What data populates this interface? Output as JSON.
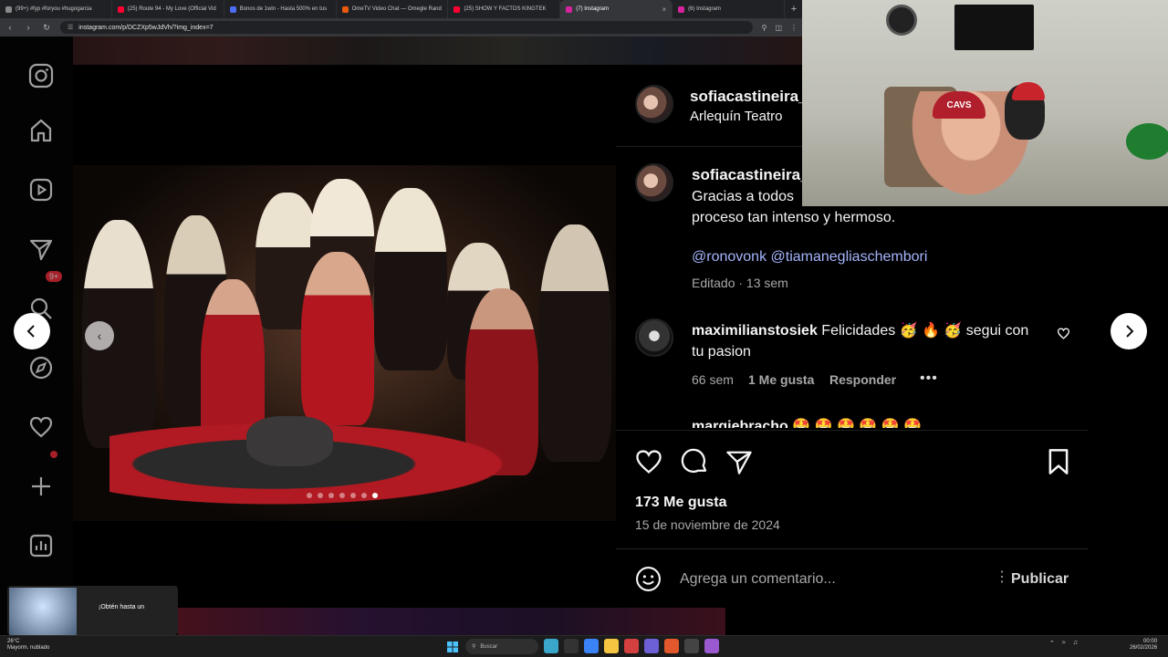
{
  "browser": {
    "tabs": [
      {
        "title": "(99+) #fyp #foryou #hugogarcia",
        "color": "#8a8a8a",
        "active": false
      },
      {
        "title": "(25) Route 94 - My Love (Official Vid",
        "color": "#ff0033",
        "active": false
      },
      {
        "title": "Bonos de 1win - Hasta 500% en tus",
        "color": "#4c6ef5",
        "active": false
      },
      {
        "title": "OmeTV Video Chat — Omegle Rand",
        "color": "#e8590c",
        "active": false
      },
      {
        "title": "(25) SHOW Y FACTOS KINGTEK",
        "color": "#ff0033",
        "active": false
      },
      {
        "title": "(7) Instagram",
        "color": "#d6249f",
        "active": true
      },
      {
        "title": "(6) Instagram",
        "color": "#d6249f",
        "active": false
      }
    ],
    "url": "instagram.com/p/DCZXp5wJdVh/?img_index=7"
  },
  "rail": {
    "badge": "9+",
    "items": [
      {
        "name": "instagram-logo-icon",
        "glyph": "logo"
      },
      {
        "name": "home-icon",
        "glyph": "home"
      },
      {
        "name": "reels-icon",
        "glyph": "reels"
      },
      {
        "name": "messages-icon",
        "glyph": "messages"
      },
      {
        "name": "search-icon",
        "glyph": "search"
      },
      {
        "name": "explore-icon",
        "glyph": "explore"
      },
      {
        "name": "notifications-icon",
        "glyph": "heart"
      },
      {
        "name": "create-icon",
        "glyph": "plus"
      },
      {
        "name": "dashboard-icon",
        "glyph": "dashboard"
      }
    ]
  },
  "post": {
    "carousel": {
      "total": 7,
      "current": 7
    },
    "author": "sofiacastineira_",
    "location": "Arlequín Teatro",
    "caption": {
      "username": "sofiacastineira_",
      "line1": "Gracias a todos",
      "line2": "proceso tan intenso y hermoso.",
      "mentions": "@ronovonk @tiamanegliaschembori",
      "meta": "Edited · 13 sem",
      "meta_display": "Editado · 13 sem"
    },
    "comments": [
      {
        "username": "maximilianstosiek",
        "text": "Felicidades 🥳 🔥 🥳 segui con tu pasion",
        "age": "66 sem",
        "likes": "1 Me gusta",
        "reply": "Responder"
      },
      {
        "username": "margiebracho",
        "text": "🤩 🤩 🤩 🤩 🤩 🤩"
      }
    ],
    "likes": "173 Me gusta",
    "date": "15 de noviembre de 2024",
    "composer": {
      "placeholder": "Agrega un comentario...",
      "publish": "Publicar"
    }
  },
  "overlay_card": {
    "text": "¡Obtén hasta un"
  },
  "taskbar": {
    "weather_temp": "26°C",
    "weather_desc": "Mayorm. nublado",
    "search": "Buscar",
    "time": "00:00",
    "date": "26/02/2026"
  }
}
